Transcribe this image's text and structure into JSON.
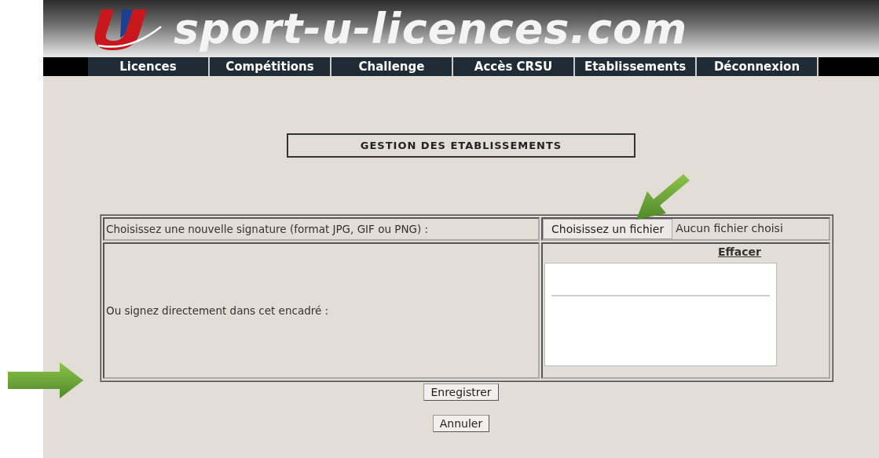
{
  "header": {
    "site_name": "sport-u-licences.com"
  },
  "nav": [
    {
      "label": "Licences"
    },
    {
      "label": "Compétitions"
    },
    {
      "label": "Challenge"
    },
    {
      "label": "Accès CRSU"
    },
    {
      "label": "Etablissements"
    },
    {
      "label": "Déconnexion"
    }
  ],
  "page_title": "GESTION DES ETABLISSEMENTS",
  "form": {
    "upload_label": "Choisissez une nouvelle signature (format JPG, GIF ou PNG) :",
    "file_button": "Choisissez un fichier",
    "file_status": "Aucun fichier choisi",
    "draw_label": "Ou signez directement dans cet encadré :",
    "clear_link": "Effacer"
  },
  "buttons": [
    "Enregistrer",
    "Annuler"
  ]
}
